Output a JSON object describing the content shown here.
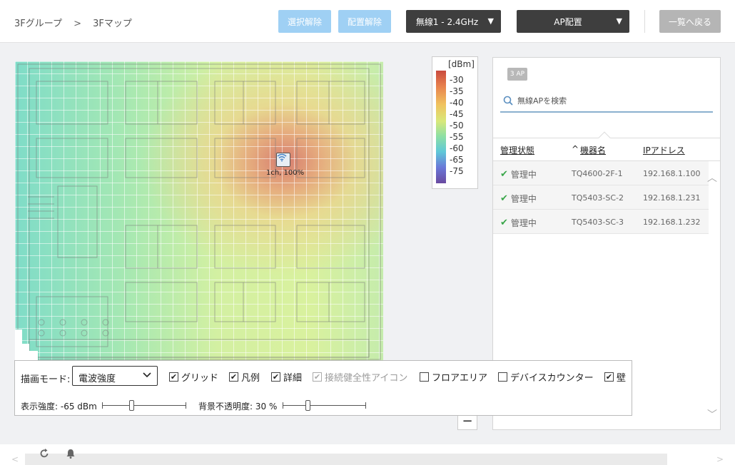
{
  "header": {
    "breadcrumb": {
      "group": "3Fグループ",
      "separator": ">",
      "map": "3Fマップ"
    },
    "buttons": {
      "deselect": "選択解除",
      "unplace": "配置解除",
      "back_to_list": "一覧へ戻る"
    },
    "radio_select": {
      "value": "無線1 - 2.4GHz"
    },
    "ap_placement_select": {
      "value": "AP配置"
    }
  },
  "map": {
    "ap_marker": {
      "icon": "wifi-icon",
      "label": "1ch, 100%"
    }
  },
  "legend": {
    "unit": "[dBm]",
    "ticks": [
      "-30",
      "-35",
      "-40",
      "-45",
      "-50",
      "-55",
      "-60",
      "-65",
      "-75"
    ]
  },
  "panel": {
    "ap_count": "3 AP",
    "search_placeholder": "無線APを検索",
    "columns": {
      "status": "管理状態",
      "sort_indicator": "^",
      "name": "機器名",
      "ip": "IPアドレス"
    },
    "rows": [
      {
        "status": "管理中",
        "name": "TQ4600-2F-1",
        "ip": "192.168.1.100"
      },
      {
        "status": "管理中",
        "name": "TQ5403-SC-2",
        "ip": "192.168.1.231"
      },
      {
        "status": "管理中",
        "name": "TQ5403-SC-3",
        "ip": "192.168.1.232"
      }
    ],
    "status_color": "#3aa64a"
  },
  "options": {
    "draw_mode_label": "描画モード:",
    "draw_mode_value": "電波強度",
    "checkboxes": {
      "grid": "グリッド",
      "legend": "凡例",
      "detail": "詳細",
      "health_icon": "接続健全性アイコン",
      "floor_area": "フロアエリア",
      "device_counter": "デバイスカウンター",
      "wall": "壁"
    },
    "checked": {
      "grid": true,
      "legend": true,
      "detail": true,
      "health_icon": true,
      "floor_area": false,
      "device_counter": false,
      "wall": true
    },
    "display_strength_label": "表示強度: -65 dBm",
    "display_strength_value": -65,
    "bg_opacity_label": "背景不透明度: 30 %",
    "bg_opacity_value": 30
  },
  "colors": {
    "accent_light": "#9fd0f4",
    "dark_button": "#3e3e3e",
    "disabled_button": "#b5b5b5"
  }
}
